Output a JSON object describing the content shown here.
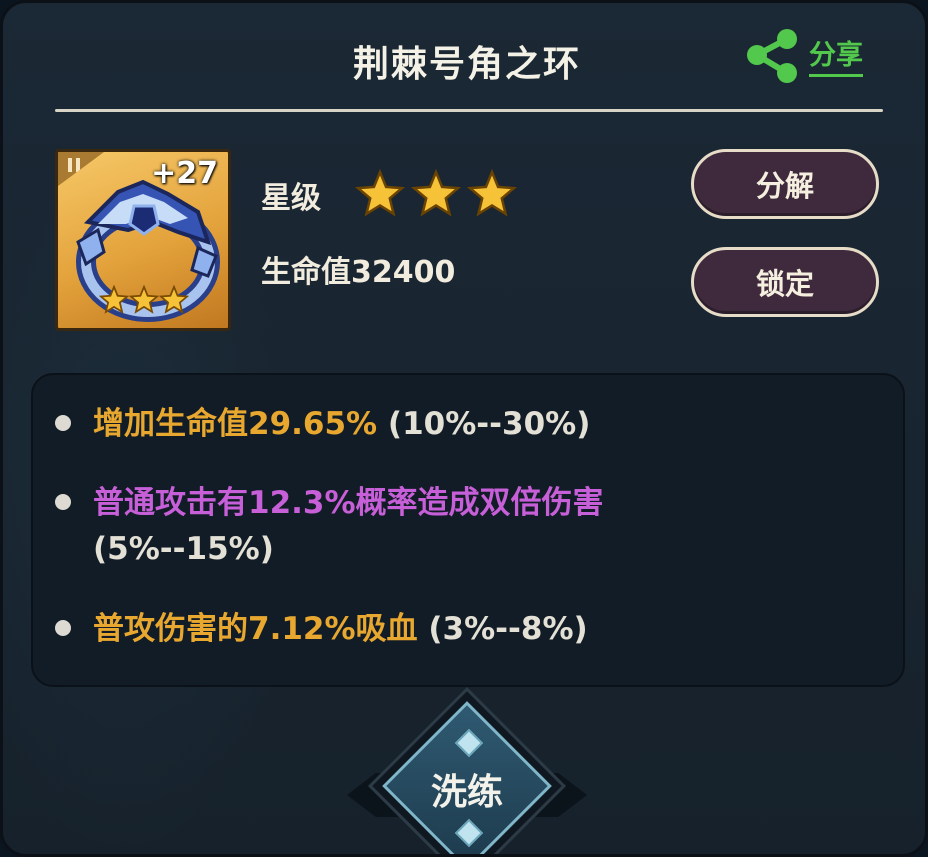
{
  "header": {
    "title": "荆棘号角之环",
    "share_label": "分享"
  },
  "item": {
    "enhance_level": "+27",
    "icon": "crown-ring-icon",
    "rarity_stars": 3
  },
  "info": {
    "star_label": "星级",
    "star_count": 3,
    "hp_text": "生命值32400"
  },
  "buttons": {
    "decompose_label": "分解",
    "lock_label": "锁定",
    "refine_label": "洗练"
  },
  "attributes": [
    {
      "text": "增加生命值29.65%",
      "range": "(10%--30%)",
      "color": "#e8a830"
    },
    {
      "text": "普通攻击有12.3%概率造成双倍伤害",
      "range": "(5%--15%)",
      "color": "#c65fd8"
    },
    {
      "text": "普攻伤害的7.12%吸血",
      "range": "(3%--8%)",
      "color": "#e8a830"
    }
  ],
  "colors": {
    "share_green": "#52c84c",
    "star_gold": "#f6c338",
    "button_fill": "#3e2a3c"
  }
}
